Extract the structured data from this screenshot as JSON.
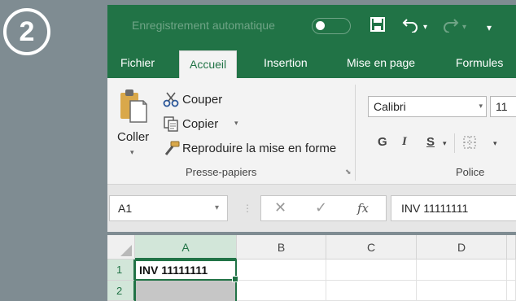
{
  "step": "2",
  "titlebar": {
    "autosave_label": "Enregistrement automatique",
    "save_icon": "save-icon",
    "undo_icon": "undo-icon",
    "redo_icon": "redo-icon"
  },
  "tabs": [
    {
      "label": "Fichier"
    },
    {
      "label": "Accueil",
      "active": true
    },
    {
      "label": "Insertion"
    },
    {
      "label": "Mise en page"
    },
    {
      "label": "Formules"
    }
  ],
  "ribbon": {
    "paste_label": "Coller",
    "cut_label": "Couper",
    "copy_label": "Copier",
    "format_painter_label": "Reproduire la mise en forme",
    "clipboard_group_label": "Presse-papiers",
    "font_name": "Calibri",
    "font_size": "11",
    "bold": "G",
    "italic": "I",
    "underline": "S",
    "font_group_label": "Police"
  },
  "formula_bar": {
    "name_box": "A1",
    "content": "INV 11111111"
  },
  "grid": {
    "columns": [
      "A",
      "B",
      "C",
      "D"
    ],
    "rows": [
      "1",
      "2"
    ],
    "cells": {
      "A1": "INV 11111111"
    }
  },
  "colors": {
    "accent": "#217346",
    "background": "#7f8c92"
  }
}
